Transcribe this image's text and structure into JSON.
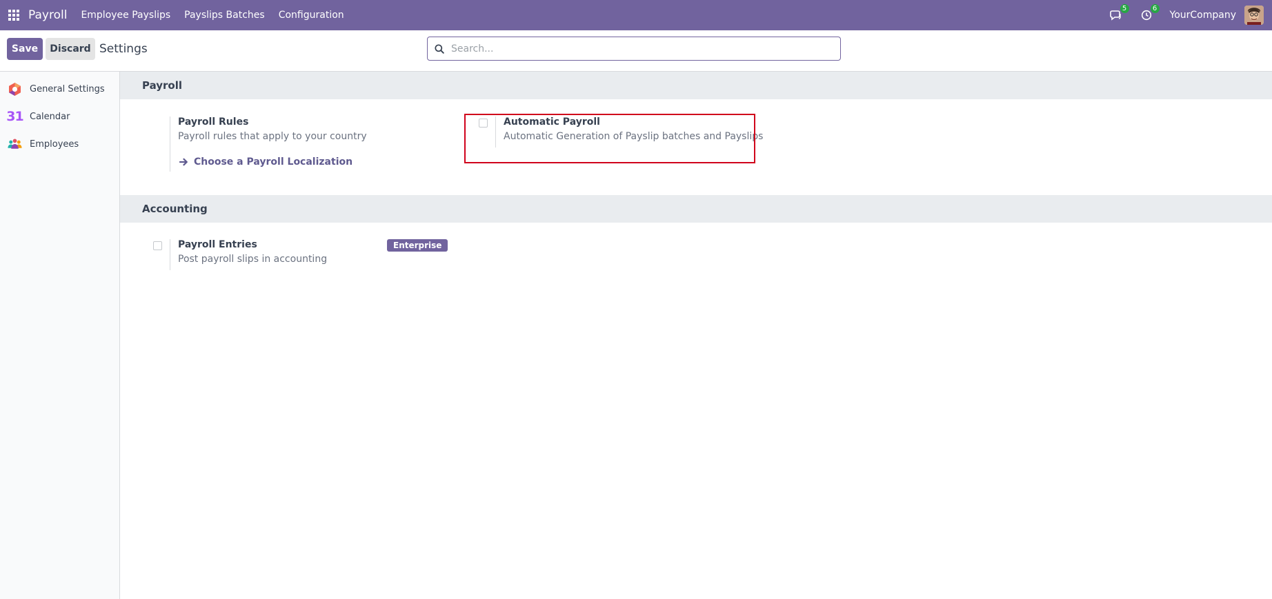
{
  "navbar": {
    "app_name": "Payroll",
    "menu": [
      "Employee Payslips",
      "Payslips Batches",
      "Configuration"
    ],
    "messages_count": "5",
    "activities_count": "6",
    "company": "YourCompany",
    "color": "#71639e"
  },
  "control": {
    "save_label": "Save",
    "discard_label": "Discard",
    "title": "Settings",
    "search_placeholder": "Search..."
  },
  "sidebar": {
    "items": [
      {
        "label": "General Settings",
        "icon": "general-settings-icon"
      },
      {
        "label": "Calendar",
        "icon": "calendar-icon",
        "icon_text": "31"
      },
      {
        "label": "Employees",
        "icon": "employees-icon"
      }
    ]
  },
  "sections": {
    "payroll": {
      "title": "Payroll",
      "rules_title": "Payroll Rules",
      "rules_desc": "Payroll rules that apply to your country",
      "rules_link": "Choose a Payroll Localization",
      "auto_title": "Automatic Payroll",
      "auto_desc": "Automatic Generation of Payslip batches and Payslips",
      "auto_checked": false
    },
    "accounting": {
      "title": "Accounting",
      "entries_title": "Payroll Entries",
      "entries_desc": "Post payroll slips in accounting",
      "entries_checked": false,
      "badge": "Enterprise"
    }
  }
}
